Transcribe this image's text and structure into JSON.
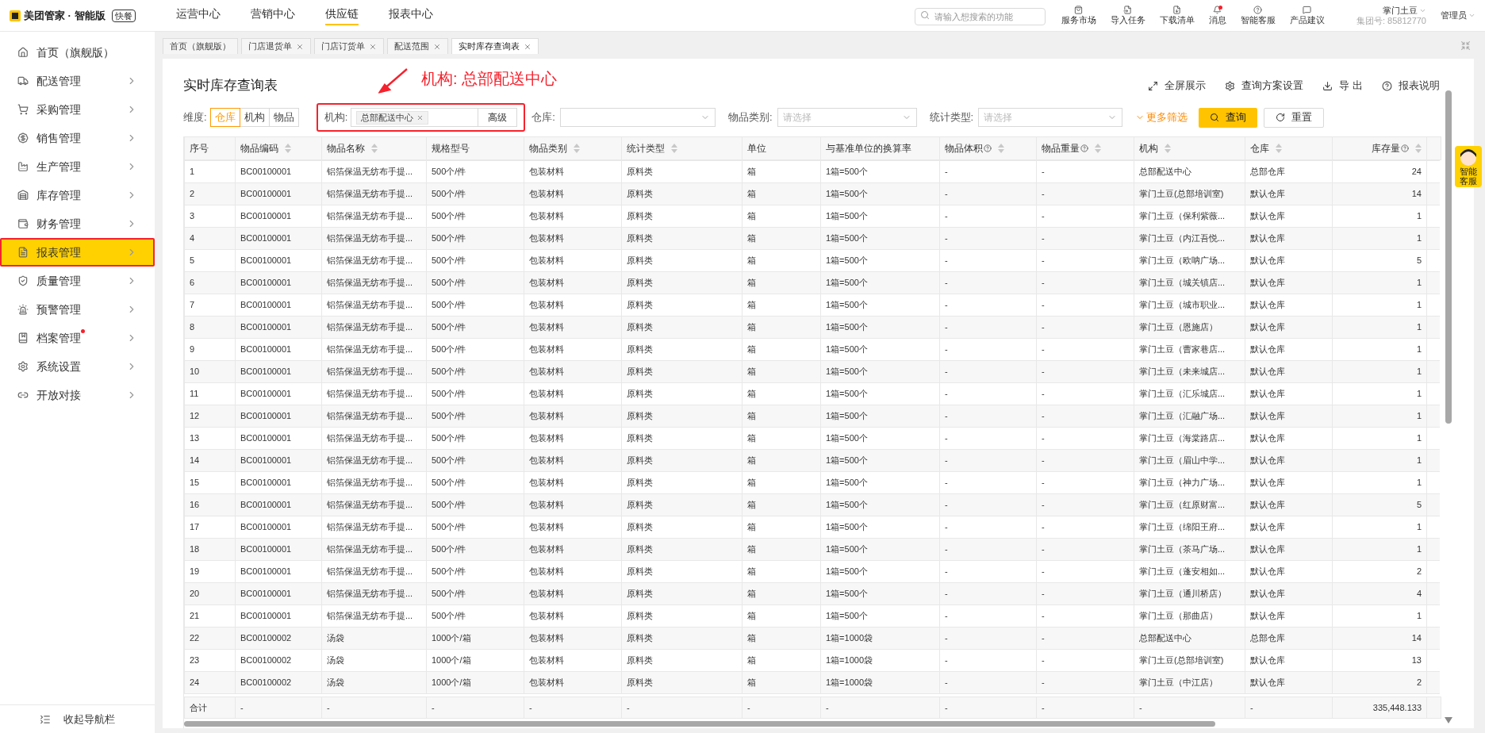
{
  "topbar": {
    "logo": "美团管家 · 智能版",
    "badge": "快餐",
    "nav": [
      {
        "label": "运营中心",
        "selected": false
      },
      {
        "label": "营销中心",
        "selected": false
      },
      {
        "label": "供应链",
        "selected": true
      },
      {
        "label": "报表中心",
        "selected": false
      }
    ],
    "search": {
      "placeholder": "请输入想搜索的功能"
    },
    "tools": [
      {
        "kind": "market",
        "label": "服务市场",
        "dot": false
      },
      {
        "kind": "import",
        "label": "导入任务",
        "dot": false
      },
      {
        "kind": "download",
        "label": "下载清单",
        "dot": false
      },
      {
        "kind": "bell",
        "label": "消息",
        "dot": true
      },
      {
        "kind": "help",
        "label": "智能客服",
        "dot": false
      },
      {
        "kind": "chat",
        "label": "产品建议",
        "dot": false
      }
    ],
    "user": {
      "name": "掌门土豆",
      "group": "集团号: 85812770",
      "role": "管理员"
    }
  },
  "sidebar": {
    "items": [
      {
        "kind": "home",
        "label": "首页（旗舰版）",
        "selected": false,
        "dot": false,
        "arrow": false
      },
      {
        "kind": "truck",
        "label": "配送管理",
        "selected": false,
        "dot": false,
        "arrow": true
      },
      {
        "kind": "cart",
        "label": "采购管理",
        "selected": false,
        "dot": false,
        "arrow": true
      },
      {
        "kind": "sale",
        "label": "销售管理",
        "selected": false,
        "dot": false,
        "arrow": true
      },
      {
        "kind": "factory",
        "label": "生产管理",
        "selected": false,
        "dot": false,
        "arrow": true
      },
      {
        "kind": "warehouse",
        "label": "库存管理",
        "selected": false,
        "dot": false,
        "arrow": true
      },
      {
        "kind": "wallet",
        "label": "财务管理",
        "selected": false,
        "dot": false,
        "arrow": true
      },
      {
        "kind": "report",
        "label": "报表管理",
        "selected": true,
        "dot": false,
        "arrow": true
      },
      {
        "kind": "shield",
        "label": "质量管理",
        "selected": false,
        "dot": false,
        "arrow": true
      },
      {
        "kind": "alarm",
        "label": "预警管理",
        "selected": false,
        "dot": false,
        "arrow": true
      },
      {
        "kind": "archive",
        "label": "档案管理",
        "selected": false,
        "dot": true,
        "arrow": true
      },
      {
        "kind": "settings",
        "label": "系统设置",
        "selected": false,
        "dot": false,
        "arrow": true
      },
      {
        "kind": "link",
        "label": "开放对接",
        "selected": false,
        "dot": false,
        "arrow": true
      }
    ],
    "collapse": "收起导航栏"
  },
  "tabs": [
    {
      "label": "首页（旗舰版）",
      "selected": false,
      "closable": false
    },
    {
      "label": "门店退货单",
      "selected": false,
      "closable": true
    },
    {
      "label": "门店订货单",
      "selected": false,
      "closable": true
    },
    {
      "label": "配送范围",
      "selected": false,
      "closable": true
    },
    {
      "label": "实时库存查询表",
      "selected": true,
      "closable": true
    }
  ],
  "page": {
    "title": "实时库存查询表",
    "assistant": "智能客服",
    "annotation": "机构: 总部配送中心",
    "actions": [
      {
        "kind": "fullscreen",
        "label": "全屏展示"
      },
      {
        "kind": "settings",
        "label": "查询方案设置"
      },
      {
        "kind": "export",
        "label": "导 出"
      },
      {
        "kind": "help",
        "label": "报表说明"
      }
    ],
    "filters": {
      "dimension": {
        "label": "维度:",
        "options": [
          {
            "label": "仓库",
            "selected": true
          },
          {
            "label": "机构",
            "selected": false
          },
          {
            "label": "物品",
            "selected": false
          }
        ]
      },
      "org": {
        "label": "机构:",
        "tag": "总部配送中心",
        "button": "高级"
      },
      "selects": [
        {
          "label": "仓库:"
        },
        {
          "label": "物品类别:",
          "placeholder": "请选择"
        },
        {
          "label": "统计类型:",
          "placeholder": "请选择"
        }
      ],
      "more": "更多筛选",
      "search": "查询",
      "reset": "重置"
    }
  },
  "table": {
    "columns": [
      {
        "label": "序号",
        "sortable": false,
        "help": false
      },
      {
        "label": "物品编码",
        "sortable": true,
        "help": false
      },
      {
        "label": "物品名称",
        "sortable": true,
        "help": false
      },
      {
        "label": "规格型号",
        "sortable": false,
        "help": false
      },
      {
        "label": "物品类别",
        "sortable": true,
        "help": false
      },
      {
        "label": "统计类型",
        "sortable": true,
        "help": false
      },
      {
        "label": "单位",
        "sortable": false,
        "help": false
      },
      {
        "label": "与基准单位的换算率",
        "sortable": false,
        "help": false
      },
      {
        "label": "物品体积",
        "sortable": true,
        "help": true
      },
      {
        "label": "物品重量",
        "sortable": true,
        "help": true
      },
      {
        "label": "机构",
        "sortable": true,
        "help": false
      },
      {
        "label": "仓库",
        "sortable": true,
        "help": false
      },
      {
        "label": "库存量",
        "sortable": true,
        "help": true
      }
    ],
    "rows": [
      [
        "1",
        "BC00100001",
        "铝箔保温无纺布手提...",
        "500个/件",
        "包装材料",
        "原料类",
        "箱",
        "1箱=500个",
        "-",
        "-",
        "总部配送中心",
        "总部仓库",
        "24"
      ],
      [
        "2",
        "BC00100001",
        "铝箔保温无纺布手提...",
        "500个/件",
        "包装材料",
        "原料类",
        "箱",
        "1箱=500个",
        "-",
        "-",
        "掌门土豆(总部培训室)",
        "默认仓库",
        "14"
      ],
      [
        "3",
        "BC00100001",
        "铝箔保温无纺布手提...",
        "500个/件",
        "包装材料",
        "原料类",
        "箱",
        "1箱=500个",
        "-",
        "-",
        "掌门土豆（保利紫薇...",
        "默认仓库",
        "1"
      ],
      [
        "4",
        "BC00100001",
        "铝箔保温无纺布手提...",
        "500个/件",
        "包装材料",
        "原料类",
        "箱",
        "1箱=500个",
        "-",
        "-",
        "掌门土豆（内江吾悦...",
        "默认仓库",
        "1"
      ],
      [
        "5",
        "BC00100001",
        "铝箔保温无纺布手提...",
        "500个/件",
        "包装材料",
        "原料类",
        "箱",
        "1箱=500个",
        "-",
        "-",
        "掌门土豆（欧呐广场...",
        "默认仓库",
        "5"
      ],
      [
        "6",
        "BC00100001",
        "铝箔保温无纺布手提...",
        "500个/件",
        "包装材料",
        "原料类",
        "箱",
        "1箱=500个",
        "-",
        "-",
        "掌门土豆（城关镇店...",
        "默认仓库",
        "1"
      ],
      [
        "7",
        "BC00100001",
        "铝箔保温无纺布手提...",
        "500个/件",
        "包装材料",
        "原料类",
        "箱",
        "1箱=500个",
        "-",
        "-",
        "掌门土豆（城市职业...",
        "默认仓库",
        "1"
      ],
      [
        "8",
        "BC00100001",
        "铝箔保温无纺布手提...",
        "500个/件",
        "包装材料",
        "原料类",
        "箱",
        "1箱=500个",
        "-",
        "-",
        "掌门土豆（恩施店）",
        "默认仓库",
        "1"
      ],
      [
        "9",
        "BC00100001",
        "铝箔保温无纺布手提...",
        "500个/件",
        "包装材料",
        "原料类",
        "箱",
        "1箱=500个",
        "-",
        "-",
        "掌门土豆（曹家巷店...",
        "默认仓库",
        "1"
      ],
      [
        "10",
        "BC00100001",
        "铝箔保温无纺布手提...",
        "500个/件",
        "包装材料",
        "原料类",
        "箱",
        "1箱=500个",
        "-",
        "-",
        "掌门土豆（未来城店...",
        "默认仓库",
        "1"
      ],
      [
        "11",
        "BC00100001",
        "铝箔保温无纺布手提...",
        "500个/件",
        "包装材料",
        "原料类",
        "箱",
        "1箱=500个",
        "-",
        "-",
        "掌门土豆（汇乐城店...",
        "默认仓库",
        "1"
      ],
      [
        "12",
        "BC00100001",
        "铝箔保温无纺布手提...",
        "500个/件",
        "包装材料",
        "原料类",
        "箱",
        "1箱=500个",
        "-",
        "-",
        "掌门土豆（汇融广场...",
        "默认仓库",
        "1"
      ],
      [
        "13",
        "BC00100001",
        "铝箔保温无纺布手提...",
        "500个/件",
        "包装材料",
        "原料类",
        "箱",
        "1箱=500个",
        "-",
        "-",
        "掌门土豆（海棠路店...",
        "默认仓库",
        "1"
      ],
      [
        "14",
        "BC00100001",
        "铝箔保温无纺布手提...",
        "500个/件",
        "包装材料",
        "原料类",
        "箱",
        "1箱=500个",
        "-",
        "-",
        "掌门土豆（眉山中学...",
        "默认仓库",
        "1"
      ],
      [
        "15",
        "BC00100001",
        "铝箔保温无纺布手提...",
        "500个/件",
        "包装材料",
        "原料类",
        "箱",
        "1箱=500个",
        "-",
        "-",
        "掌门土豆（神力广场...",
        "默认仓库",
        "1"
      ],
      [
        "16",
        "BC00100001",
        "铝箔保温无纺布手提...",
        "500个/件",
        "包装材料",
        "原料类",
        "箱",
        "1箱=500个",
        "-",
        "-",
        "掌门土豆（红原财富...",
        "默认仓库",
        "5"
      ],
      [
        "17",
        "BC00100001",
        "铝箔保温无纺布手提...",
        "500个/件",
        "包装材料",
        "原料类",
        "箱",
        "1箱=500个",
        "-",
        "-",
        "掌门土豆（绵阳王府...",
        "默认仓库",
        "1"
      ],
      [
        "18",
        "BC00100001",
        "铝箔保温无纺布手提...",
        "500个/件",
        "包装材料",
        "原料类",
        "箱",
        "1箱=500个",
        "-",
        "-",
        "掌门土豆（茶马广场...",
        "默认仓库",
        "1"
      ],
      [
        "19",
        "BC00100001",
        "铝箔保温无纺布手提...",
        "500个/件",
        "包装材料",
        "原料类",
        "箱",
        "1箱=500个",
        "-",
        "-",
        "掌门土豆（蓬安相如...",
        "默认仓库",
        "2"
      ],
      [
        "20",
        "BC00100001",
        "铝箔保温无纺布手提...",
        "500个/件",
        "包装材料",
        "原料类",
        "箱",
        "1箱=500个",
        "-",
        "-",
        "掌门土豆（通川桥店）",
        "默认仓库",
        "4"
      ],
      [
        "21",
        "BC00100001",
        "铝箔保温无纺布手提...",
        "500个/件",
        "包装材料",
        "原料类",
        "箱",
        "1箱=500个",
        "-",
        "-",
        "掌门土豆（那曲店）",
        "默认仓库",
        "1"
      ],
      [
        "22",
        "BC00100002",
        "汤袋",
        "1000个/箱",
        "包装材料",
        "原料类",
        "箱",
        "1箱=1000袋",
        "-",
        "-",
        "总部配送中心",
        "总部仓库",
        "14"
      ],
      [
        "23",
        "BC00100002",
        "汤袋",
        "1000个/箱",
        "包装材料",
        "原料类",
        "箱",
        "1箱=1000袋",
        "-",
        "-",
        "掌门土豆(总部培训室)",
        "默认仓库",
        "13"
      ],
      [
        "24",
        "BC00100002",
        "汤袋",
        "1000个/箱",
        "包装材料",
        "原料类",
        "箱",
        "1箱=1000袋",
        "-",
        "-",
        "掌门土豆（中江店）",
        "默认仓库",
        "2"
      ]
    ],
    "footer": [
      "合计",
      "-",
      "-",
      "-",
      "-",
      "-",
      "-",
      "-",
      "-",
      "-",
      "-",
      "-",
      "335,448.133"
    ]
  }
}
